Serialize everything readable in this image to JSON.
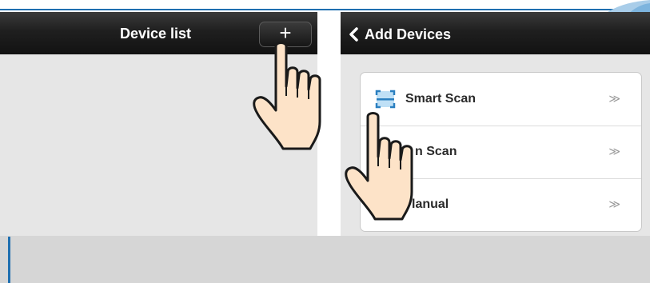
{
  "left_panel": {
    "title": "Device list",
    "add_button_label": "+"
  },
  "right_panel": {
    "title": "Add Devices",
    "back_icon": "chevron-left-icon",
    "options": [
      {
        "label": "Smart Scan",
        "icon": "scan-icon",
        "arrow": "≫"
      },
      {
        "label": "n Scan",
        "icon": "lan-icon",
        "arrow": "≫"
      },
      {
        "label": "lanual",
        "icon": "manual-icon",
        "arrow": "≫"
      }
    ]
  },
  "colors": {
    "titlebar": "#1f1f1f",
    "accent": "#1f6fb0",
    "hand_skin": "#fde3c8"
  }
}
